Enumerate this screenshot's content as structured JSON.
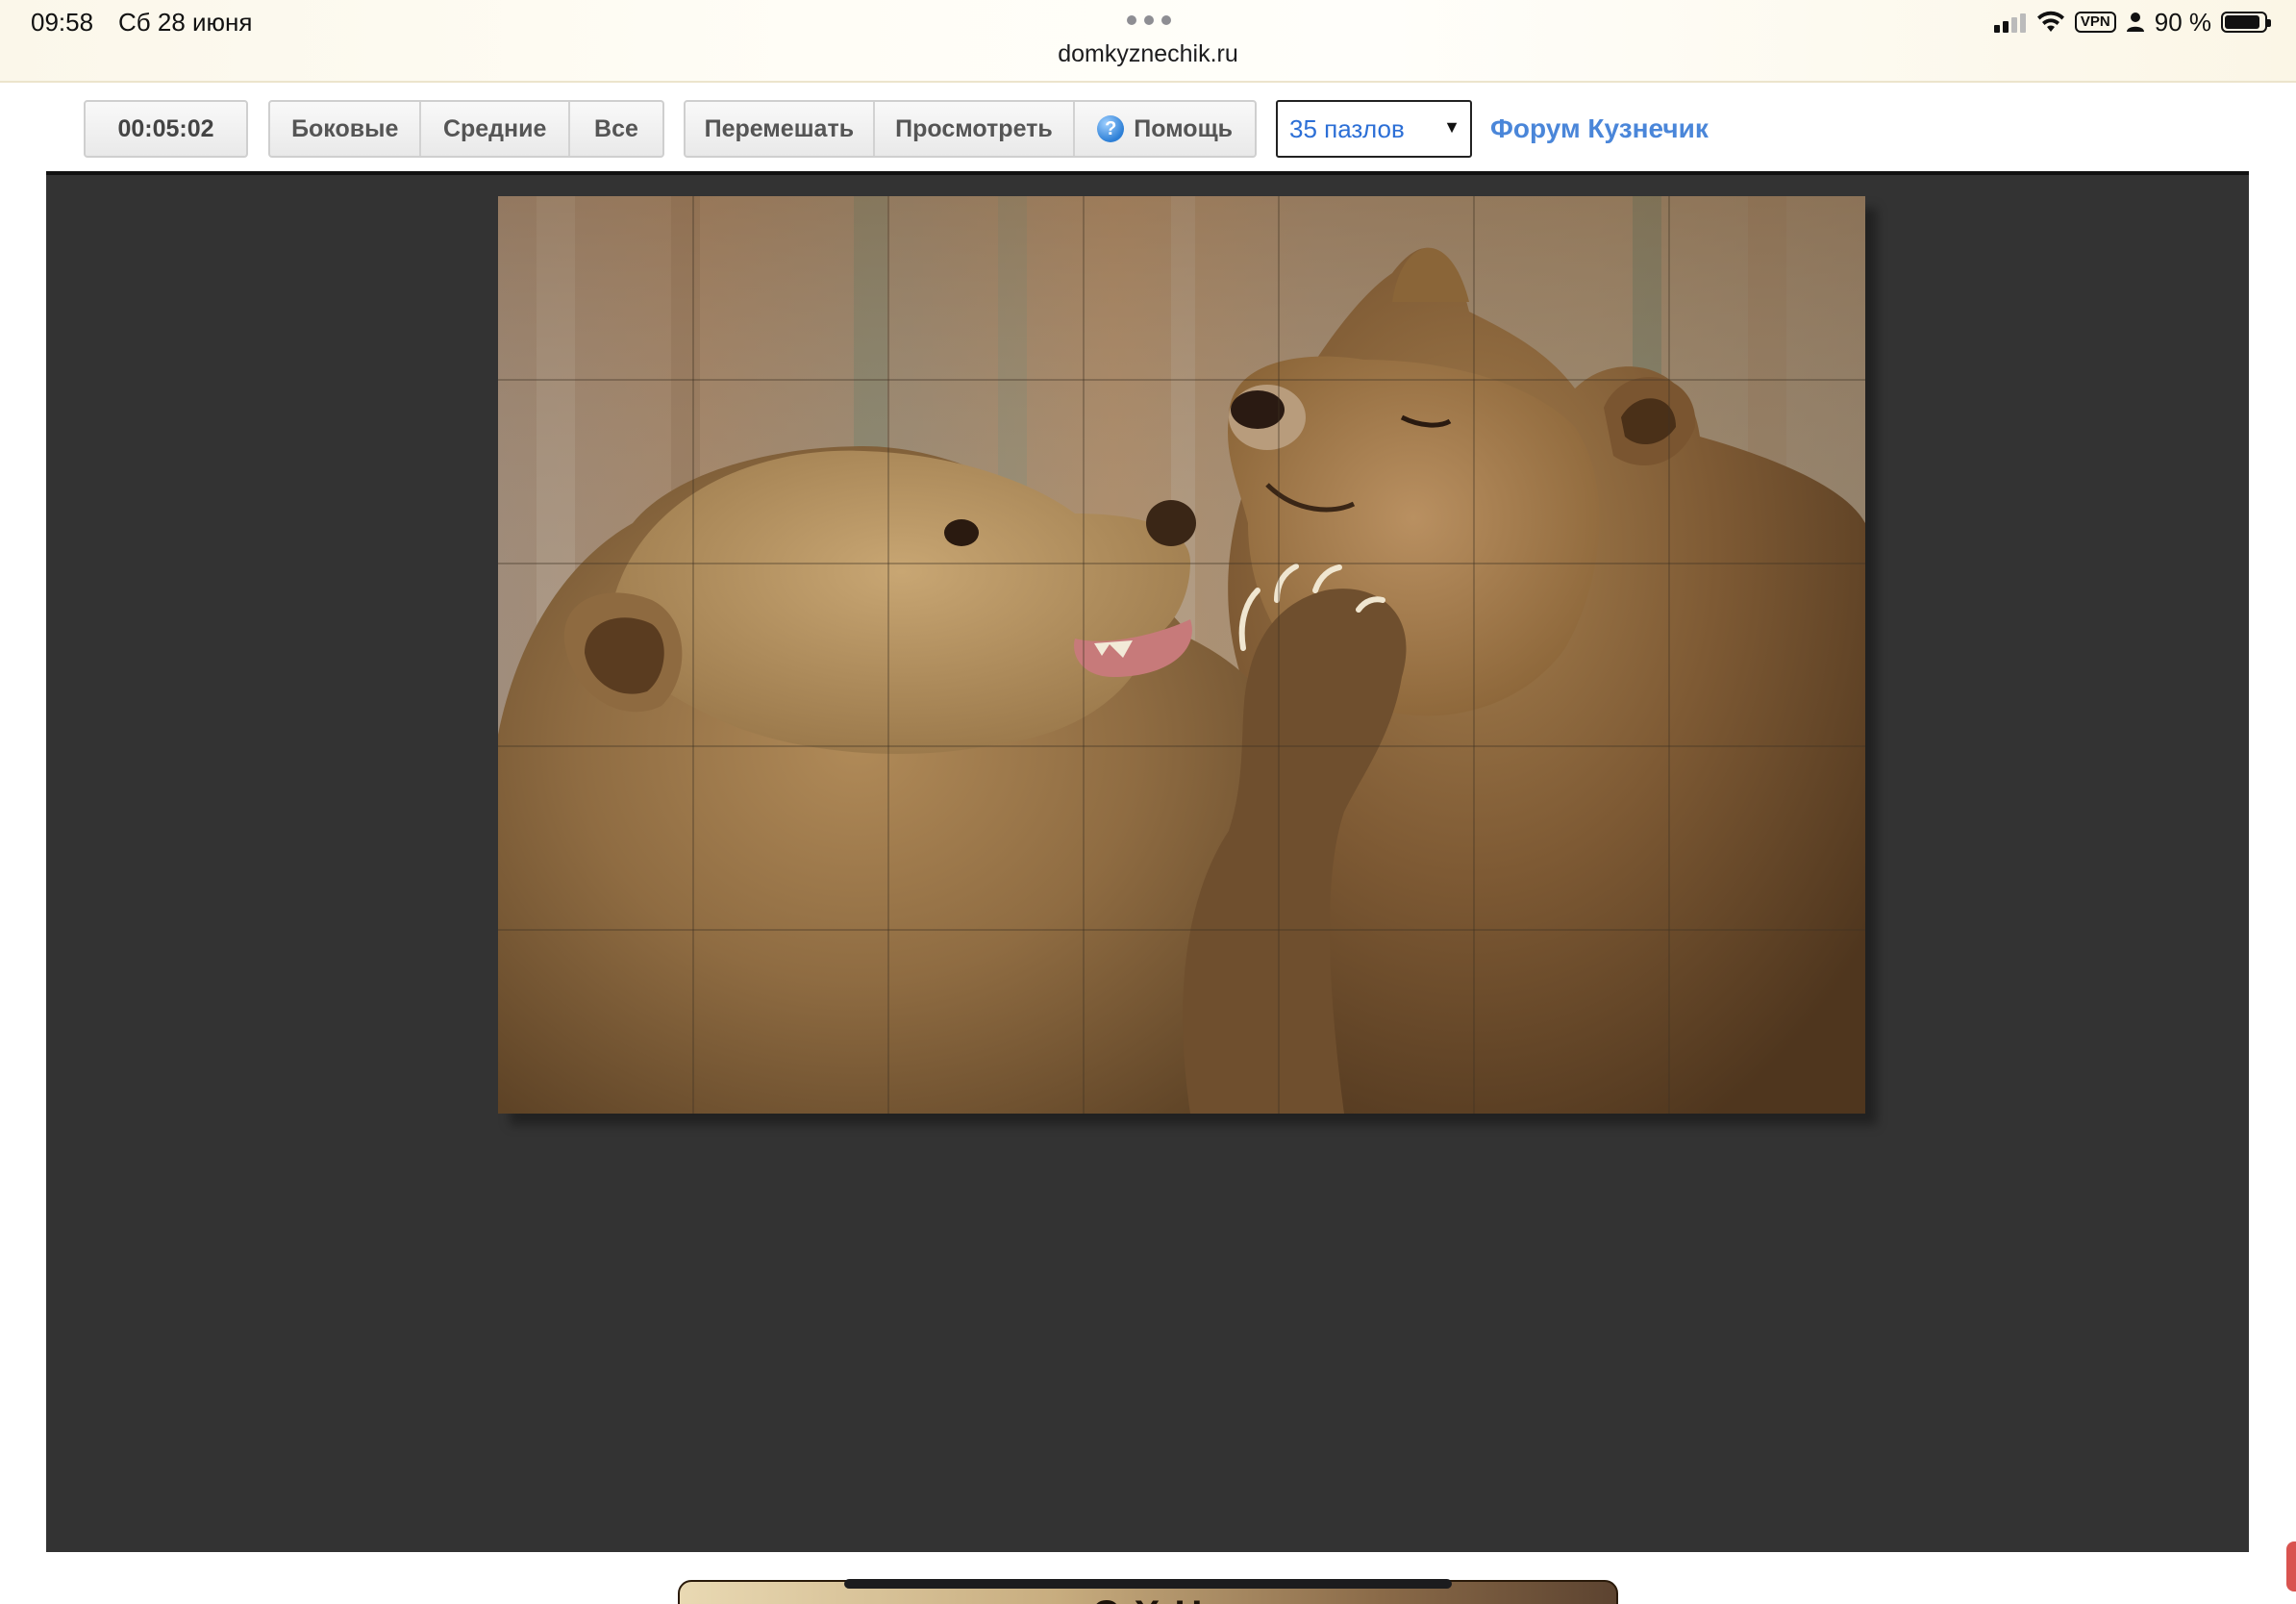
{
  "status_bar": {
    "time": "09:58",
    "date": "Сб 28 июня",
    "url": "domkyznechik.ru",
    "vpn_label": "VPN",
    "battery_text": "90 %",
    "battery_level": 0.9
  },
  "toolbar": {
    "timer": "00:05:02",
    "filter_buttons": [
      "Боковые",
      "Средние",
      "Все"
    ],
    "action_buttons": {
      "shuffle": "Перемешать",
      "preview": "Просмотреть",
      "help": "Помощь"
    },
    "help_icon_glyph": "?",
    "pieces_select": {
      "value": "35 пазлов",
      "arrow": "▼"
    },
    "forum_link": "Форум Кузнечик"
  },
  "puzzle": {
    "grid_columns": 7,
    "grid_rows": 5,
    "image_subject": "two-brown-bears"
  },
  "colors": {
    "game_background": "#333333",
    "link": "#4a86d9",
    "select_text": "#2c6fd6"
  },
  "bottom_banner": {
    "partial_text": "С          Х          Н"
  }
}
